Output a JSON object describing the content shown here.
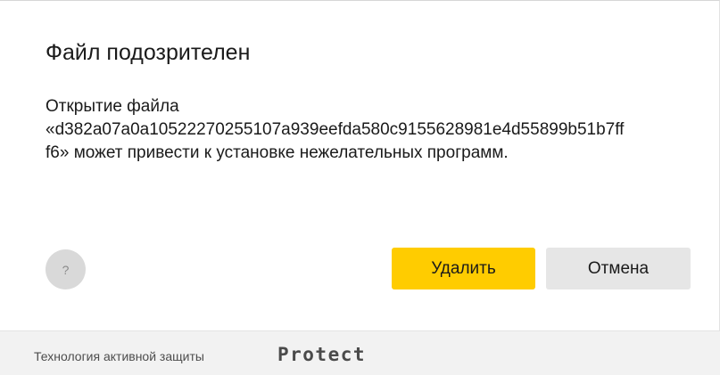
{
  "dialog": {
    "title": "Файл подозрителен",
    "message_line1": "Открытие файла",
    "message_line2": "«d382a07a0a10522270255107a939eefda580c9155628981e4d55899b51b7ff",
    "message_line3": "f6» может привести к установке нежелательных программ.",
    "help_label": "?",
    "delete_label": "Удалить",
    "cancel_label": "Отмена"
  },
  "footer": {
    "text": "Технология активной защиты",
    "brand": "Protect"
  },
  "colors": {
    "accent": "#ffcc00",
    "secondary_button": "#e6e6e6",
    "help_button": "#d9d9d9",
    "footer_bg": "#f2f2f2"
  },
  "icons": {
    "help": "question-mark-icon"
  }
}
